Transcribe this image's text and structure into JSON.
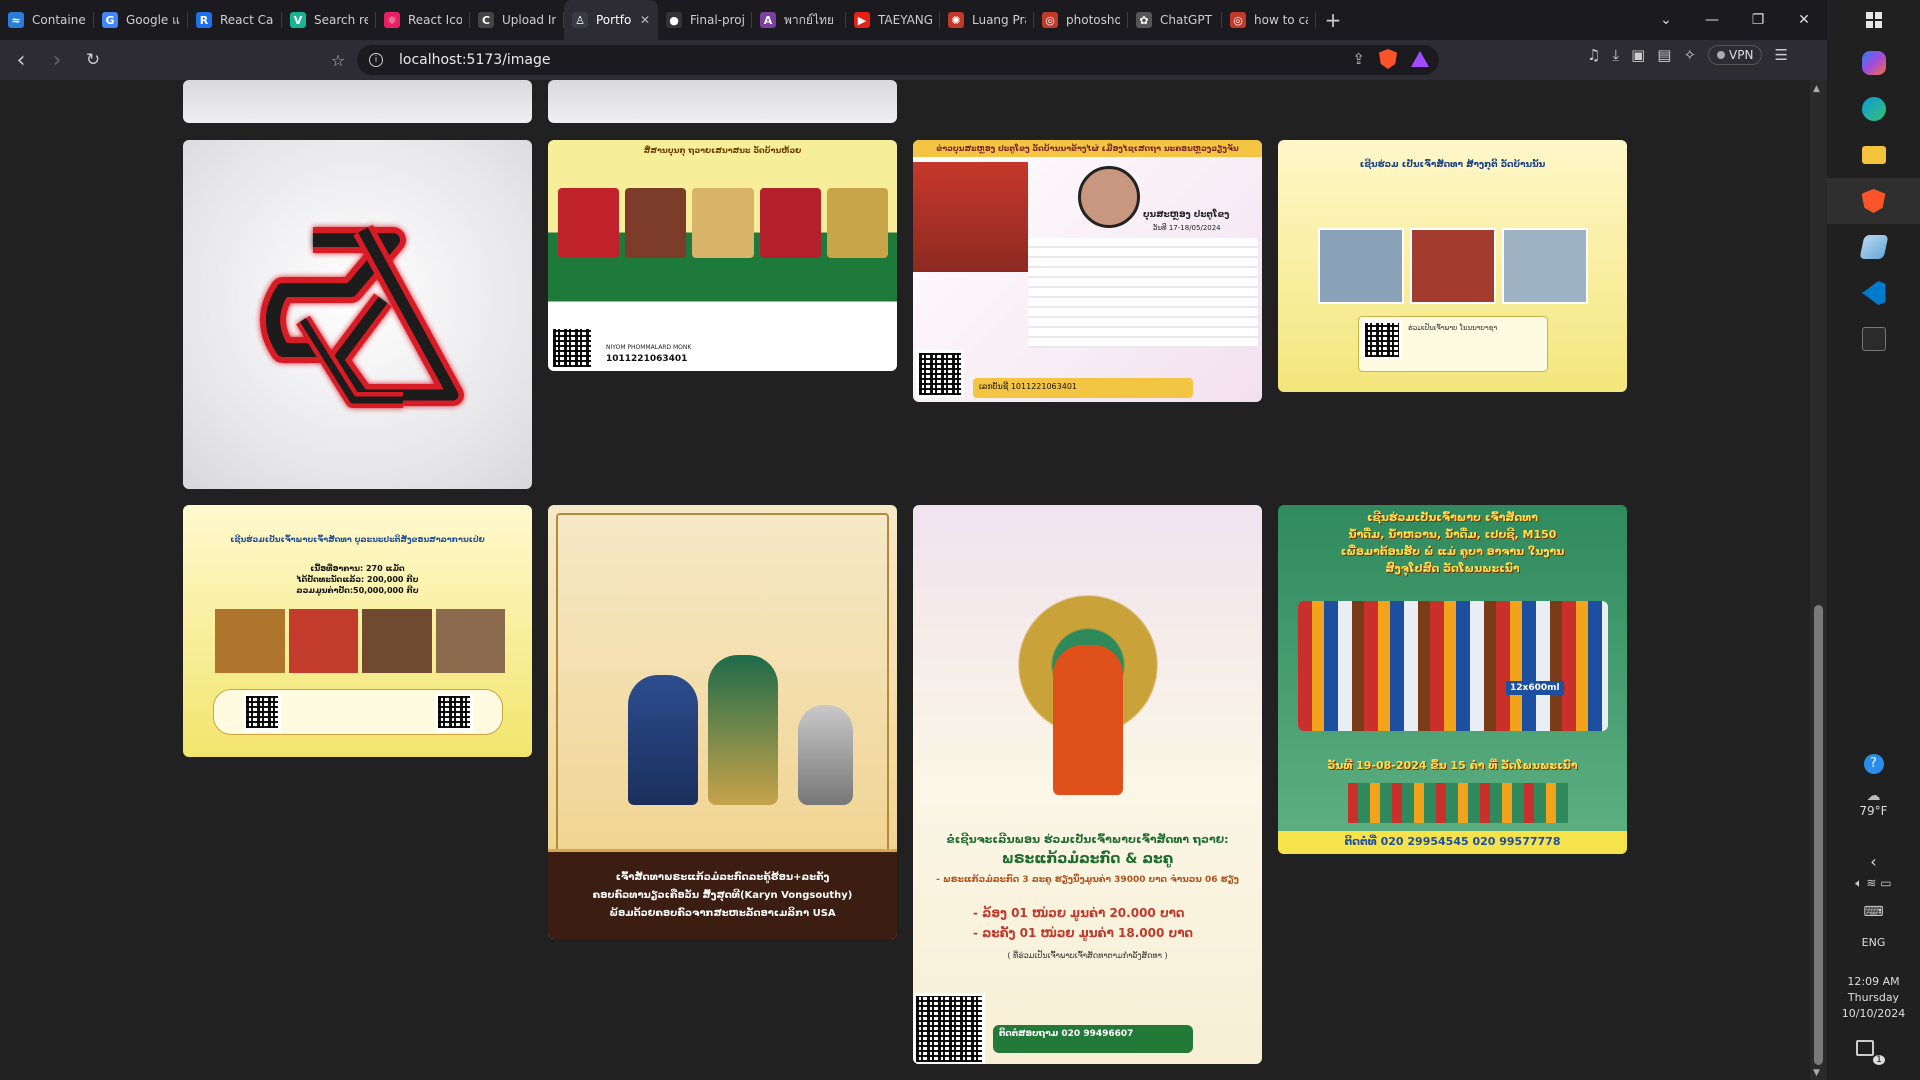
{
  "browser": {
    "tabs": [
      {
        "label": "Container -",
        "fav_color": "#2b7bd9",
        "fav_glyph": "≈"
      },
      {
        "label": "Google แปล",
        "fav_color": "#4285f4",
        "fav_glyph": "G"
      },
      {
        "label": "React Card -",
        "fav_color": "#1f6feb",
        "fav_glyph": "R"
      },
      {
        "label": "Search resu",
        "fav_color": "#1ab394",
        "fav_glyph": "V"
      },
      {
        "label": "React Icons",
        "fav_color": "#e91e63",
        "fav_glyph": "⚛"
      },
      {
        "label": "Upload Ima",
        "fav_color": "#444444",
        "fav_glyph": "C"
      },
      {
        "label": "Portfoli",
        "fav_color": "#3a3a42",
        "fav_glyph": "♙",
        "active": true
      },
      {
        "label": "Final-projec",
        "fav_color": "#333333",
        "fav_glyph": "●"
      },
      {
        "label": "พากย์ไทย - F",
        "fav_color": "#7b3fa0",
        "fav_glyph": "A"
      },
      {
        "label": "TAEYANG -",
        "fav_color": "#e62117",
        "fav_glyph": "▶"
      },
      {
        "label": "Luang Prab",
        "fav_color": "#c0392b",
        "fav_glyph": "✺"
      },
      {
        "label": "photoshop",
        "fav_color": "#c0392b",
        "fav_glyph": "◎"
      },
      {
        "label": "ChatGPT",
        "fav_color": "#555555",
        "fav_glyph": "✿"
      },
      {
        "label": "how to cap",
        "fav_color": "#c0392b",
        "fav_glyph": "◎"
      }
    ],
    "new_tab_glyph": "+",
    "window_controls": {
      "dropdown": "⌄",
      "minimize": "—",
      "restore": "❐",
      "close": "✕"
    },
    "nav": {
      "back": "‹",
      "forward": "›",
      "reload": "↻"
    },
    "url": "localhost:5173/image",
    "vpn_label": "VPN"
  },
  "gallery": {
    "cards": [
      {
        "id": "top-1",
        "kind": "partial"
      },
      {
        "id": "top-2",
        "kind": "partial"
      },
      {
        "id": "logo",
        "kind": "logo"
      },
      {
        "id": "poster-1",
        "heading": "ສື່ສານບຸນກຸ ຖວາຍເສນາສນະ ວັດບ້ານຫ້ວຍ",
        "footer": "1011221063401",
        "account": "NIYOM PHOMMALARD MONK"
      },
      {
        "id": "poster-2",
        "heading": "ຂ່າວບຸນສະຫຼອງ ປະຕູໂຂງ ວັດບ້ານນາຂ້າງໄຜ່ ເມືອງໄຊເສດຖາ ນະຄອນຫຼວງວຽງຈັນ",
        "name": "ບຸນສະຫຼອງ ປະຕູໂຂງ",
        "date": "ວັນທີ 17-18/05/2024",
        "footer": "ເລກບັນຊີ 1011221063401"
      },
      {
        "id": "poster-3",
        "heading": "ເຊີນຮ່ວມ ເປັນເຈົ້າສັດທາ ສ້າງກຸຕິ ວັດບ້ານນັ້ນ",
        "footer": "ຮ່ວມເປັນເຈົ້າພາບ ໂນນນາບາຊາ"
      },
      {
        "id": "poster-4",
        "heading": "ເຊີນຮ່ວມເປັນເຈົ້າພາບເຈົ້າສັດທາ ບູລະນະປະຕິສັງຂອນສາລາການເປ່ຍ",
        "lines": [
          "ເນື້ອທີ່ອາຄານ: 270 ແມັດ",
          "ໄດ້ປັດທະນັດແລ້ວ: 200,000 ກີບ",
          "ລວມມູນຄ່າປັດ:50,000,000 ກີບ"
        ]
      },
      {
        "id": "poster-5",
        "caption": [
          "ເຈົ້າສັດທາພຣະແກ້ວມໍລະກົດລະຄູ້ຮ້ອນ+ລະຄັງ",
          "ຄອບຄົວທານຽວເຄືອວັນ ສົ້ງສຸດທີ(Karyn Vongsouthy)",
          "ພ້ອມດ້ວຍຄອບຄົວຈາກສະຫະລັດອາເມລິກາ USA"
        ]
      },
      {
        "id": "poster-6",
        "title": "ຂໍເຊີນຈະເລີນພອນ ຮ່ວມເປັນເຈົ້າພາບເຈົ້າສັດທາ ຖວາຍ:",
        "subtitle": "ພຣະແກ້ວມໍລະກົດ & ລະຄູ",
        "line": "- ພຣະແກ້ວມໍລະກົດ 3 ລະຄູ ຮຽງນຶ່ງມູນຄ່າ 39000 ບາດ ຈໍານວນ 06 ຮຽງ",
        "items": [
          "- ລ້ອງ 01 ໜ່ວຍ ມູນຄ່າ 20.000 ບາດ",
          "- ລະຄັງ 01 ໜ່ວຍ ມູນຄ່າ 18.000 ບາດ"
        ],
        "note": "( ທີ່ຮ່ວມເປັນເຈົ້າພາບເຈົ້າສັດທາຕາມກຳລັງສັດທາ )",
        "contact": "ຕິດຕໍ່ສອບຖາມ 020 99496607"
      },
      {
        "id": "poster-7",
        "heading": [
          "ເຊີນຮ່ວມເປັນເຈົ້າພາບ ເຈົ້າສັດທາ",
          "ນ້ຳດື່ມ, ນ້ຳຫວານ, ນ້ຳດື່ມ, ເປບຊີ, M150",
          "ເພື່ອມາຕ້ອນຮັບ ພໍ່ ແມ່ ຄູບາ ອາຈານ ໃນງານ",
          "ສົງຈຸໂປສົດ ວັດໂພນພະເນົາ"
        ],
        "date": "ວັນທີ 19-08-2024 ຂຶ້ນ 15 ຄ່ຳ ທີ່ ວັດໂພນພະເນົາ",
        "contact": "ຕິດຕໍ່ທີ່ 020 29954545 020 99577778",
        "pack": "12x600ml"
      }
    ]
  },
  "taskbar": {
    "weather_temp": "79°F",
    "lang": "ENG",
    "time": "12:09 AM",
    "day": "Thursday",
    "date": "10/10/2024",
    "notif_count": "1",
    "tray_chevron": "‹"
  },
  "colors": {
    "brave": "#fb542b",
    "vscode": "#007acc",
    "edge": "#0c9bd8"
  }
}
